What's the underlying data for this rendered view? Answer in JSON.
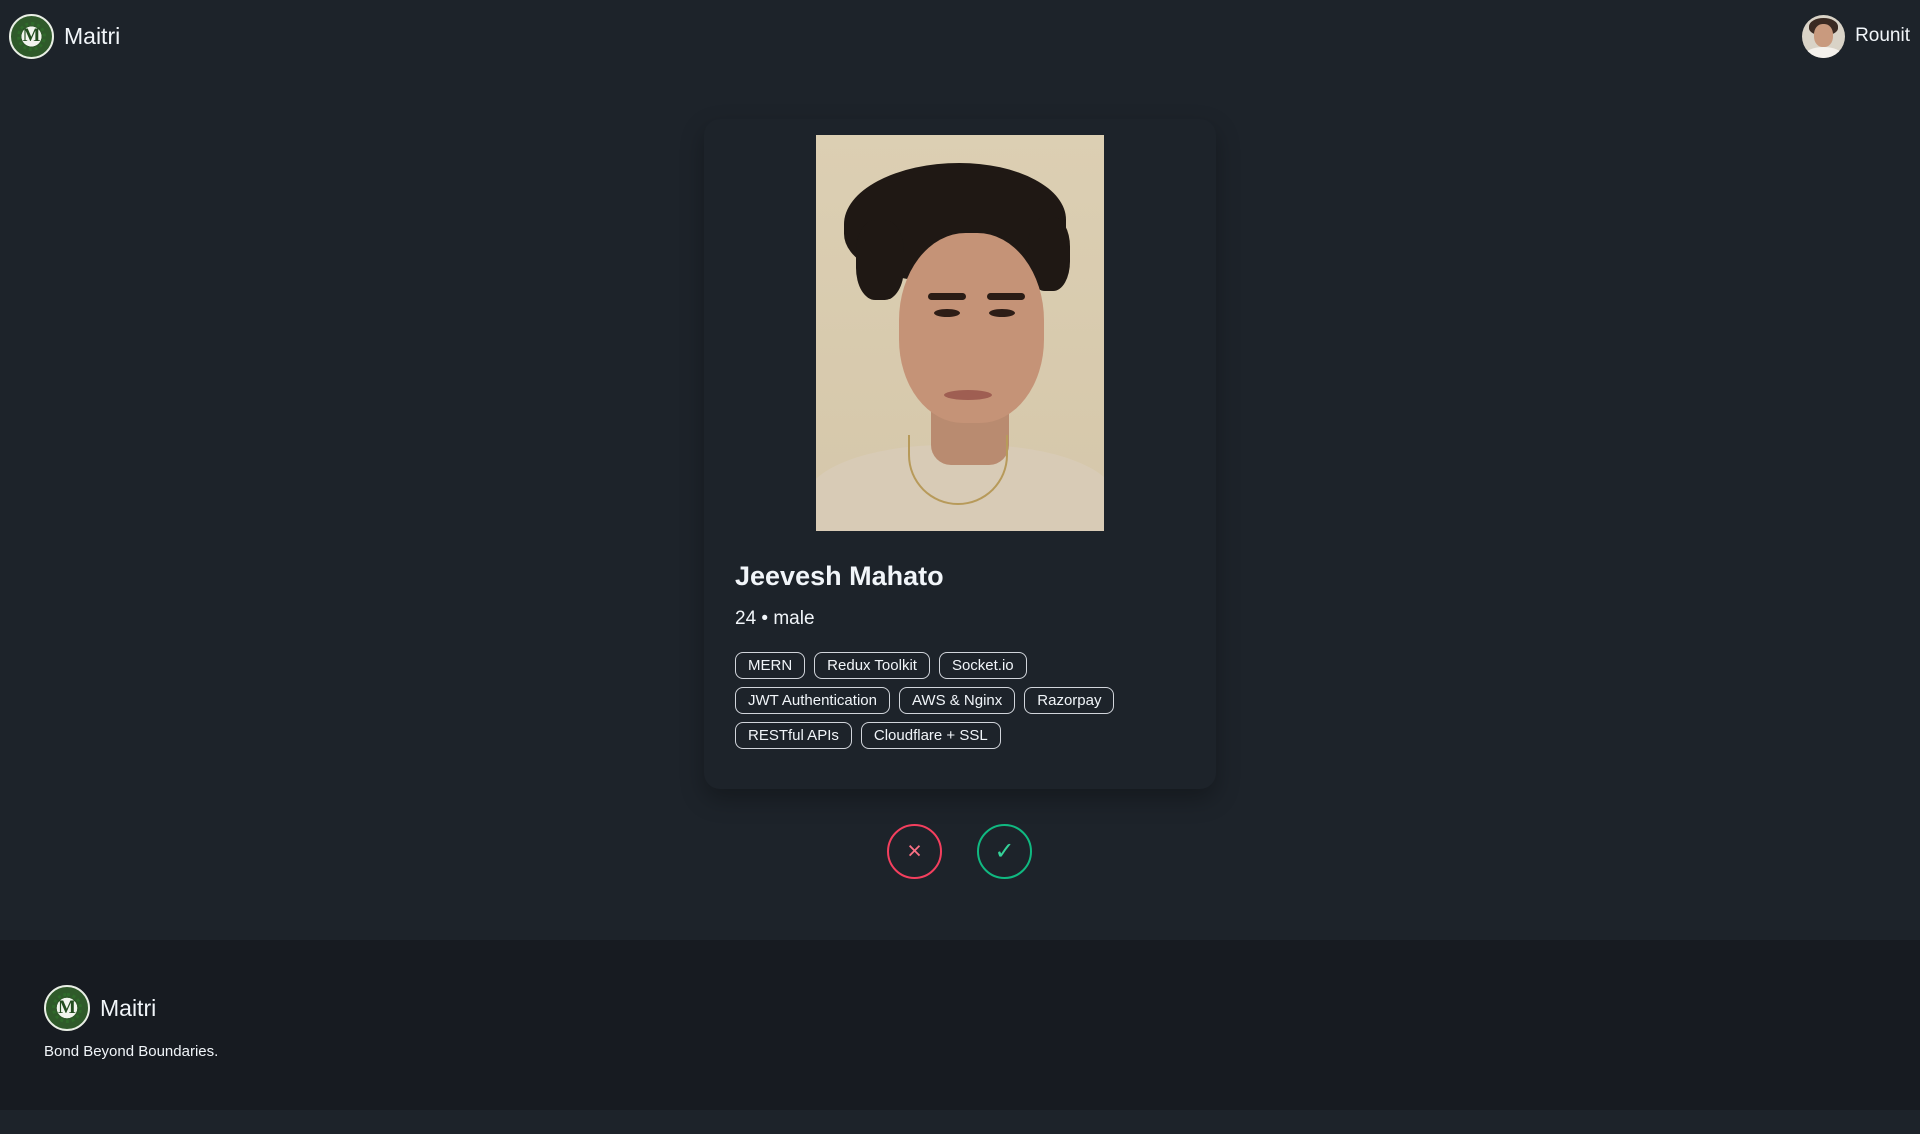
{
  "navbar": {
    "brand": "Maitri",
    "user_name": "Rounit"
  },
  "profile": {
    "name": "Jeevesh Mahato",
    "meta": "24 • male",
    "tags": [
      "MERN",
      "Redux Toolkit",
      "Socket.io",
      "JWT Authentication",
      "AWS & Nginx",
      "Razorpay",
      "RESTful APIs",
      "Cloudflare + SSL"
    ]
  },
  "actions": {
    "reject_icon": "×",
    "accept_icon": "✓"
  },
  "footer": {
    "brand": "Maitri",
    "tagline": "Bond Beyond Boundaries."
  },
  "colors": {
    "background": "#1d232a",
    "footer_background": "#171b21",
    "reject": "#f43f5e",
    "accept": "#10b981"
  },
  "icons": {
    "brand_logo": "maitri-logo-icon",
    "user_avatar": "avatar",
    "reject_button": "close-icon",
    "accept_button": "check-icon"
  }
}
